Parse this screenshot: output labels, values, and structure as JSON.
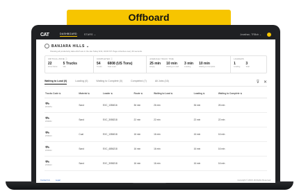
{
  "banner": {
    "label": "Offboard"
  },
  "topbar": {
    "logo": "CAT",
    "nav": [
      {
        "label": "DASHBOARD"
      },
      {
        "label": "STARS ⌄"
      }
    ],
    "user": "Jonathan, TRBob ⌄"
  },
  "site": {
    "name": "BANJARA HILLS ⌄",
    "subtitle": "Showing all productivity data which are in the site Today 6/13, 04:00 IST. Page refreshes every 30 seconds."
  },
  "stats": [
    {
      "title": "CRITICAL ZONE ⓘ",
      "vals": [
        {
          "v": "22",
          "l": "Zone Name"
        },
        {
          "v": "5 Trucks",
          "l": "Idle"
        }
      ]
    },
    {
      "title": "COMPLETED ⓘ",
      "vals": [
        {
          "v": "54",
          "l": "Trucks"
        },
        {
          "v": "6808 (US Tons)",
          "l": "Total Load"
        }
      ]
    },
    {
      "title": "AVERAGE TRACK TIME",
      "vals": [
        {
          "v": "25 min",
          "l": "Empty"
        },
        {
          "v": "10 min",
          "l": "Waiting to Load"
        },
        {
          "v": "3 min",
          "l": "Loading"
        },
        {
          "v": "10 min",
          "l": "Waiting to Complete"
        }
      ]
    },
    {
      "title": "LOADERS",
      "vals": [
        {
          "v": "1",
          "l": "Loading"
        },
        {
          "v": "3",
          "l": "Total"
        }
      ]
    }
  ],
  "tabs": [
    {
      "label": "Waiting to Load (0)"
    },
    {
      "label": "Loading (0)"
    },
    {
      "label": "Waiting to Complete (0)"
    },
    {
      "label": "Completed (7)"
    },
    {
      "label": "All Jobs (16)"
    }
  ],
  "table": {
    "headers": [
      "Trucks Code ⇅",
      "Material ⇅",
      "Loader ⇅",
      "Route ⇅",
      "Waiting to Load ⇅",
      "Loading ⇅",
      "Waiting to Complete ⇅"
    ],
    "rows": [
      {
        "truck": "WC8051",
        "material": "Sand",
        "loader": "EXC_1356016",
        "route": "36 min",
        "wait_load": "26 min",
        "loading": "36 min",
        "wait_complete": "26 min"
      },
      {
        "truck": "WS8052",
        "material": "Sand",
        "loader": "EXC_3058218",
        "route": "22 min",
        "wait_load": "22 min",
        "loading": "22 min",
        "wait_complete": "22 min"
      },
      {
        "truck": "WS8013",
        "material": "Coal",
        "loader": "EXC_1356018",
        "route": "16 min",
        "wait_load": "16 min",
        "loading": "16 min",
        "wait_complete": "16 min"
      },
      {
        "truck": "WS8022",
        "material": "Sand",
        "loader": "EXC_4856218",
        "route": "16 min",
        "wait_load": "16 min",
        "loading": "16 min",
        "wait_complete": "16 min"
      },
      {
        "truck": "WS8023",
        "material": "Sand",
        "loader": "EXC_3058218",
        "route": "16 min",
        "wait_load": "16 min",
        "loading": "16 min",
        "wait_complete": "16 min"
      }
    ]
  },
  "footer": {
    "links": [
      {
        "label": "Contact Us"
      },
      {
        "label": "Legal"
      }
    ],
    "copyright": "Copyright © 2018. All Rights Reserved."
  }
}
